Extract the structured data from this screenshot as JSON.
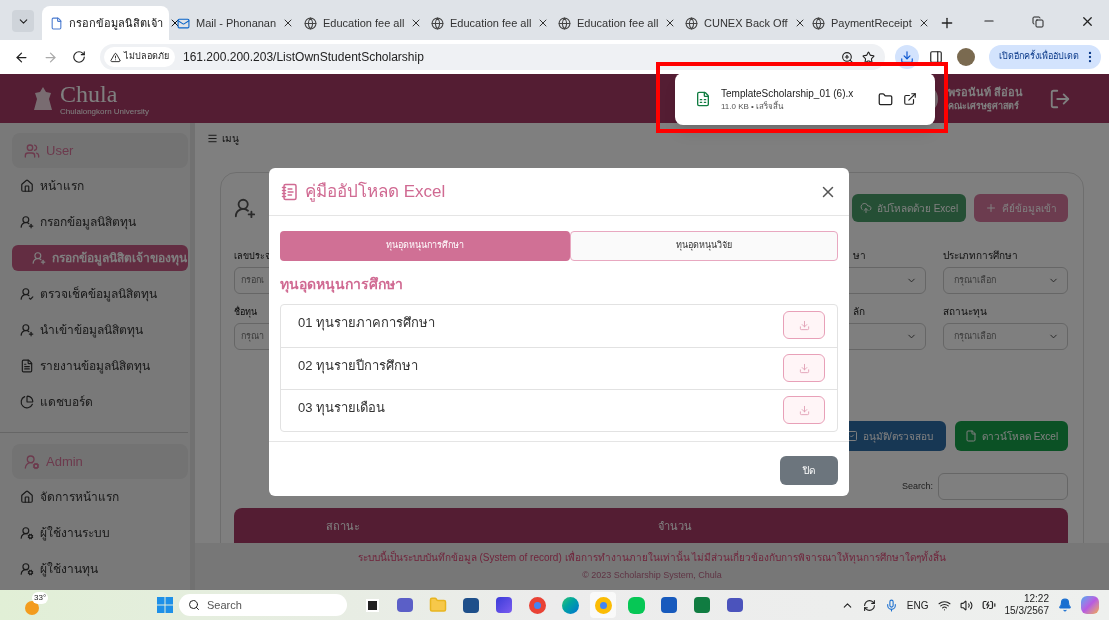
{
  "browser": {
    "tabs": [
      {
        "title": "กรอกข้อมูลนิสิตเจ้า",
        "selected": true
      },
      {
        "title": "Mail - Phonanan",
        "selected": false
      },
      {
        "title": "Education fee all",
        "selected": false
      },
      {
        "title": "Education fee all",
        "selected": false
      },
      {
        "title": "Education fee all",
        "selected": false
      },
      {
        "title": "CUNEX Back Off",
        "selected": false
      },
      {
        "title": "PaymentReceipt",
        "selected": false
      }
    ],
    "security_label": "ไม่ปลอดภัย",
    "url": "161.200.200.203/ListOwnStudentScholarship",
    "update_button": "เปิดอีกครั้งเพื่ออัปเดต"
  },
  "download_popup": {
    "file_name": "TemplateScholarship_01 (6).x",
    "details": "11.0 KB • เสร็จสิ้น"
  },
  "header": {
    "logo_text": "Chula",
    "logo_subtitle": "Chulalongkorn University",
    "user_name": "พรอนันท์ สีอ่อน",
    "user_faculty": "คณะเศรษฐศาสตร์"
  },
  "sidebar": {
    "sections": [
      {
        "title": "User",
        "items": [
          {
            "label": "หน้าแรก",
            "selected": false
          },
          {
            "label": "กรอกข้อมูลนิสิตทุน",
            "selected": false
          },
          {
            "label": "กรอกข้อมูลนิสิตเจ้าของทุน",
            "selected": true
          },
          {
            "label": "ตรวจเช็คข้อมูลนิสิตทุน",
            "selected": false
          },
          {
            "label": "นำเข้าข้อมูลนิสิตทุน",
            "selected": false
          },
          {
            "label": "รายงานข้อมูลนิสิตทุน",
            "selected": false
          },
          {
            "label": "แดชบอร์ด",
            "selected": false
          }
        ]
      },
      {
        "title": "Admin",
        "items": [
          {
            "label": "จัดการหน้าแรก",
            "selected": false
          },
          {
            "label": "ผู้ใช้งานระบบ",
            "selected": false
          },
          {
            "label": "ผู้ใช้งานทุน",
            "selected": false
          }
        ]
      }
    ]
  },
  "menu_label": "เมนู",
  "card": {
    "top_buttons": [
      {
        "label": "อัปโหลดด้วย Excel",
        "kind": "upload"
      },
      {
        "label": "คีย์ข้อมูลเข้า",
        "kind": "add"
      }
    ],
    "left_fields": [
      {
        "label": "เลขประจ",
        "placeholder": "กรอกเ"
      },
      {
        "label": "ชื่อทุน",
        "placeholder": "กรุณา"
      }
    ],
    "filter_rows": [
      [
        {
          "label": "ษา"
        },
        {
          "label": "ประเภทการศึกษา",
          "placeholder": "กรุณาเลือก"
        }
      ],
      [
        {
          "label": "ลัก"
        },
        {
          "label": "สถานะทุน",
          "placeholder": "กรุณาเลือก"
        }
      ]
    ],
    "action_buttons": [
      {
        "label": "อนุมัติ/ตรวจสอบ",
        "kind": "approve"
      },
      {
        "label": "ดาวน์โหลด Excel",
        "kind": "download"
      }
    ],
    "search_label": "Search:",
    "table_headers": [
      "สถานะ",
      "จำนวน"
    ]
  },
  "modal": {
    "title": "คู่มืออัปโหลด Excel",
    "tabs": [
      {
        "label": "ทุนอุดหนุนการศึกษา",
        "selected": true
      },
      {
        "label": "ทุนอุดหนุนวิจัย",
        "selected": false
      }
    ],
    "section_title": "ทุนอุดหนุนการศึกษา",
    "items": [
      {
        "label": "01 ทุนรายภาคการศึกษา"
      },
      {
        "label": "02 ทุนรายปีการศึกษา"
      },
      {
        "label": "03 ทุนรายเดือน"
      }
    ],
    "close_button": "ปิด"
  },
  "footer": {
    "notice": "ระบบนี้เป็นระบบบันทึกข้อมูล (System of record) เพื่อการทำงานภายในเท่านั้น ไม่มีส่วนเกี่ยวข้องกับการพิจารณาให้ทุนการศึกษาใดๆทั้งสิ้น",
    "copyright": "© 2023 Scholarship System, Chula"
  },
  "taskbar": {
    "temperature": "33°",
    "search_placeholder": "Search",
    "language": "ENG",
    "time": "12:22",
    "date": "15/3/2567"
  }
}
